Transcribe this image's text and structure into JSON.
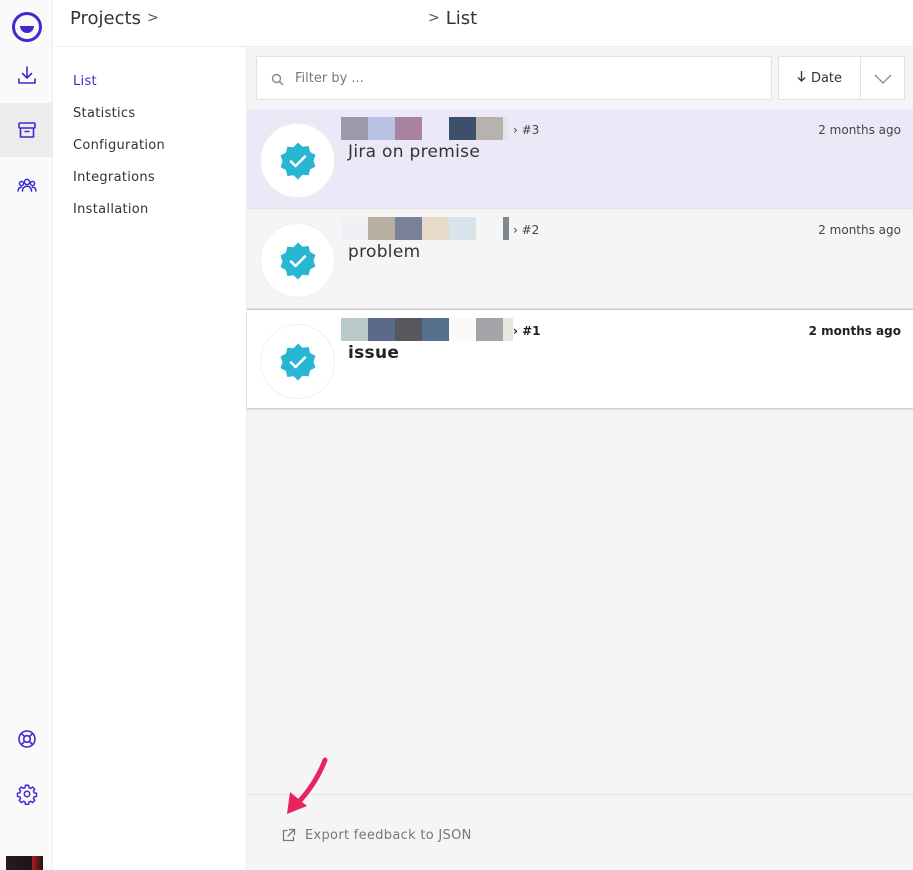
{
  "app": {
    "accent_color": "#3d2bd1",
    "badge_color": "#29b6d3",
    "highlight_row_color": "#ebe9f7"
  },
  "rail": {
    "icons": [
      "logo-icon",
      "download-icon",
      "inbox-icon",
      "users-icon",
      "help-icon",
      "settings-icon"
    ]
  },
  "header": {
    "breadcrumb_projects": "Projects",
    "breadcrumb_list": "List"
  },
  "sidebar": {
    "items": [
      {
        "label": "List",
        "active": true
      },
      {
        "label": "Statistics",
        "active": false
      },
      {
        "label": "Configuration",
        "active": false
      },
      {
        "label": "Integrations",
        "active": false
      },
      {
        "label": "Installation",
        "active": false
      }
    ]
  },
  "toolbar": {
    "search_placeholder": "Filter by ...",
    "sort_label": "Date",
    "sort_direction": "descending"
  },
  "feedback": [
    {
      "ref": "› #3",
      "title": "Jira on premise",
      "age": "2 months ago",
      "status": "verified",
      "unread": false,
      "selected": true
    },
    {
      "ref": "› #2",
      "title": "problem",
      "age": "2 months ago",
      "status": "verified",
      "unread": false,
      "selected": false
    },
    {
      "ref": "› #1",
      "title": "issue",
      "age": "2 months ago",
      "status": "verified",
      "unread": true,
      "selected": false
    }
  ],
  "footer": {
    "export_label": "Export feedback to JSON"
  }
}
